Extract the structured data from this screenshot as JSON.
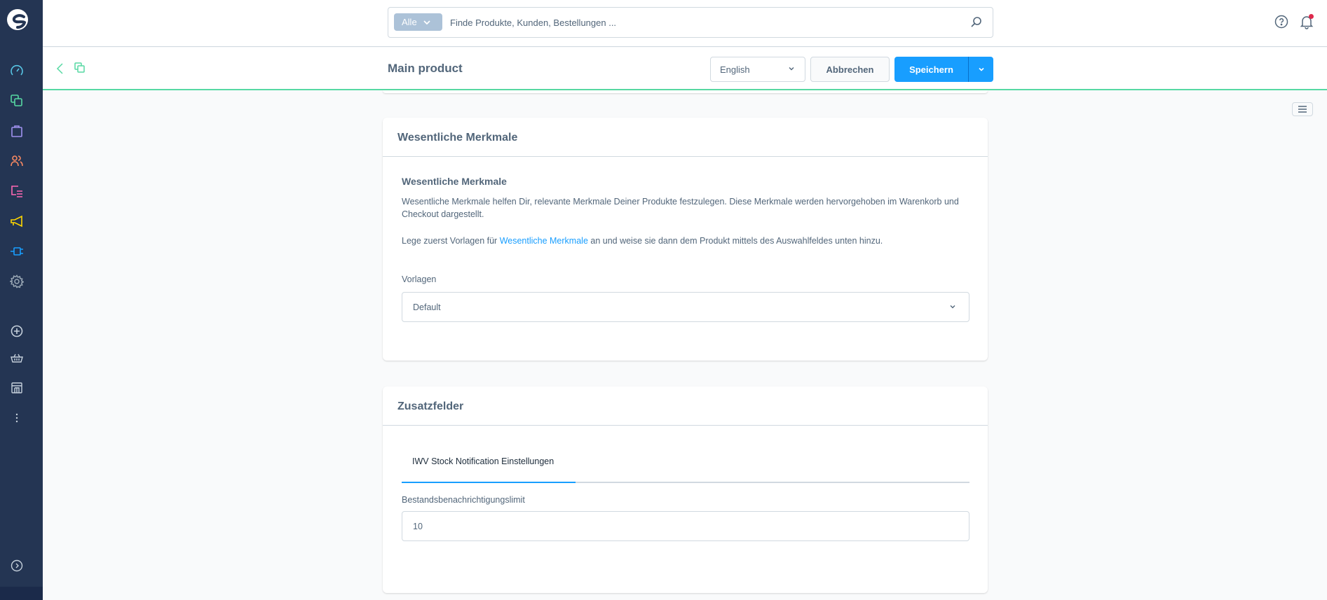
{
  "sidebar": {
    "items": [
      {
        "name": "dashboard",
        "color": "#57c6e5"
      },
      {
        "name": "catalogues",
        "color": "#57d9a3"
      },
      {
        "name": "orders",
        "color": "#a092f0"
      },
      {
        "name": "customers",
        "color": "#f88962"
      },
      {
        "name": "content",
        "color": "#ff68b4"
      },
      {
        "name": "marketing",
        "color": "#ffd700"
      },
      {
        "name": "extensions",
        "color": "#189eff"
      },
      {
        "name": "settings",
        "color": "#9aa8b5"
      }
    ],
    "secondary": [
      "add-sales-channel",
      "storefront-basket",
      "storefront-shop",
      "more"
    ],
    "expand_label": "expand"
  },
  "search": {
    "type_label": "Alle",
    "placeholder": "Finde Produkte, Kunden, Bestellungen ..."
  },
  "smartbar": {
    "title": "Main product",
    "language": "English",
    "cancel_label": "Abbrechen",
    "save_label": "Speichern"
  },
  "essential_features": {
    "card_title": "Wesentliche Merkmale",
    "title": "Wesentliche Merkmale",
    "description": "Wesentliche Merkmale helfen Dir, relevante Merkmale Deiner Produkte festzulegen. Diese Merkmale werden hervorgehoben im Warenkorb und Checkout dargestellt.",
    "hint_before": "Lege zuerst Vorlagen für ",
    "hint_link": "Wesentliche Merkmale",
    "hint_after": " an und weise sie dann dem Produkt mittels des Auswahlfeldes unten hinzu.",
    "templates_label": "Vorlagen",
    "templates_value": "Default"
  },
  "custom_fields": {
    "card_title": "Zusatzfelder",
    "tabs": [
      {
        "label": "IWV Stock Notification Einstellungen",
        "active": true
      }
    ],
    "field_label": "Bestandsbenachrichtigungslimit",
    "field_value": "10"
  },
  "colors": {
    "accent": "#189eff",
    "sidebar_bg": "#243553",
    "smartbar_border": "#57d9a3",
    "notification": "#de294c"
  }
}
